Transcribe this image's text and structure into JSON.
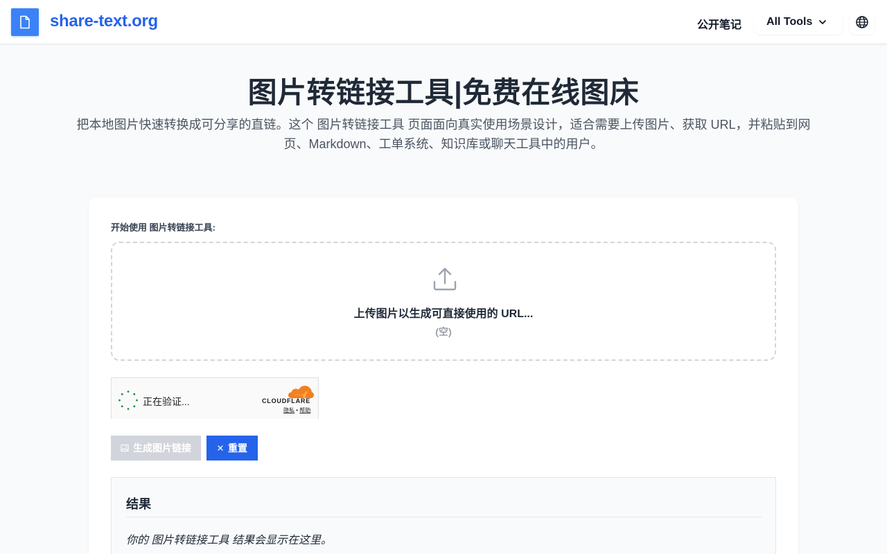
{
  "header": {
    "brand": "share-text.org",
    "nav_notes": "公开笔记",
    "tools_label": "All Tools"
  },
  "hero": {
    "title": "图片转链接工具|免费在线图床",
    "description": "把本地图片快速转换成可分享的直链。这个 图片转链接工具 页面面向真实使用场景设计，适合需要上传图片、获取 URL，并粘贴到网页、Markdown、工单系统、知识库或聊天工具中的用户。"
  },
  "tool": {
    "start_label": "开始使用 图片转链接工具:",
    "drop_title": "上传图片以生成可直接使用的 URL...",
    "drop_empty": "(空)"
  },
  "turnstile": {
    "status": "正在验证...",
    "brand": "CLOUDFLARE",
    "privacy": "隐私",
    "separator": "•",
    "help": "帮助"
  },
  "buttons": {
    "generate": "生成图片链接",
    "reset": "重置"
  },
  "result": {
    "title": "结果",
    "placeholder": "你的 图片转链接工具 结果会显示在这里。"
  },
  "colors": {
    "accent": "#2563eb",
    "logo_bg": "#3b82f6",
    "disabled": "#d1d5db",
    "cloudflare_orange": "#f38020"
  },
  "icons": {
    "logo": "document-icon",
    "tools": "chevron-down-icon",
    "language": "globe-icon",
    "upload": "upload-icon",
    "generate": "image-icon",
    "reset": "close-icon"
  }
}
